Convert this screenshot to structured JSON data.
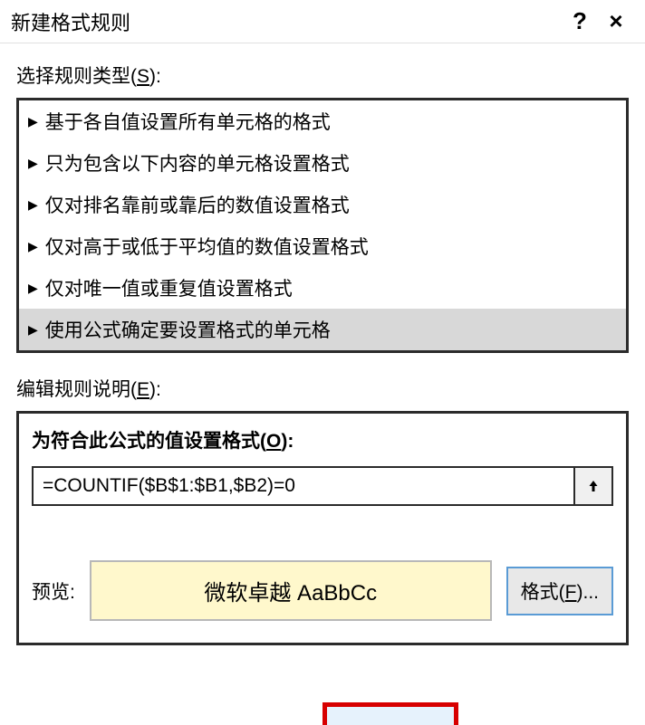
{
  "titlebar": {
    "title": "新建格式规则",
    "help": "?",
    "close": "×"
  },
  "ruleType": {
    "label_prefix": "选择规则类型(",
    "label_key": "S",
    "label_suffix": "):",
    "items": [
      "基于各自值设置所有单元格的格式",
      "只为包含以下内容的单元格设置格式",
      "仅对排名靠前或靠后的数值设置格式",
      "仅对高于或低于平均值的数值设置格式",
      "仅对唯一值或重复值设置格式",
      "使用公式确定要设置格式的单元格"
    ],
    "selectedIndex": 5
  },
  "editDesc": {
    "label_prefix": "编辑规则说明(",
    "label_key": "E",
    "label_suffix": "):",
    "formulaTitle_prefix": "为符合此公式的值设置格式(",
    "formulaTitle_key": "O",
    "formulaTitle_suffix": "):",
    "formula": "=COUNTIF($B$1:$B1,$B2)=0",
    "previewLabel": "预览:",
    "previewSample": "微软卓越 AaBbCc",
    "formatBtn_prefix": "格式(",
    "formatBtn_key": "F",
    "formatBtn_suffix": ")..."
  }
}
